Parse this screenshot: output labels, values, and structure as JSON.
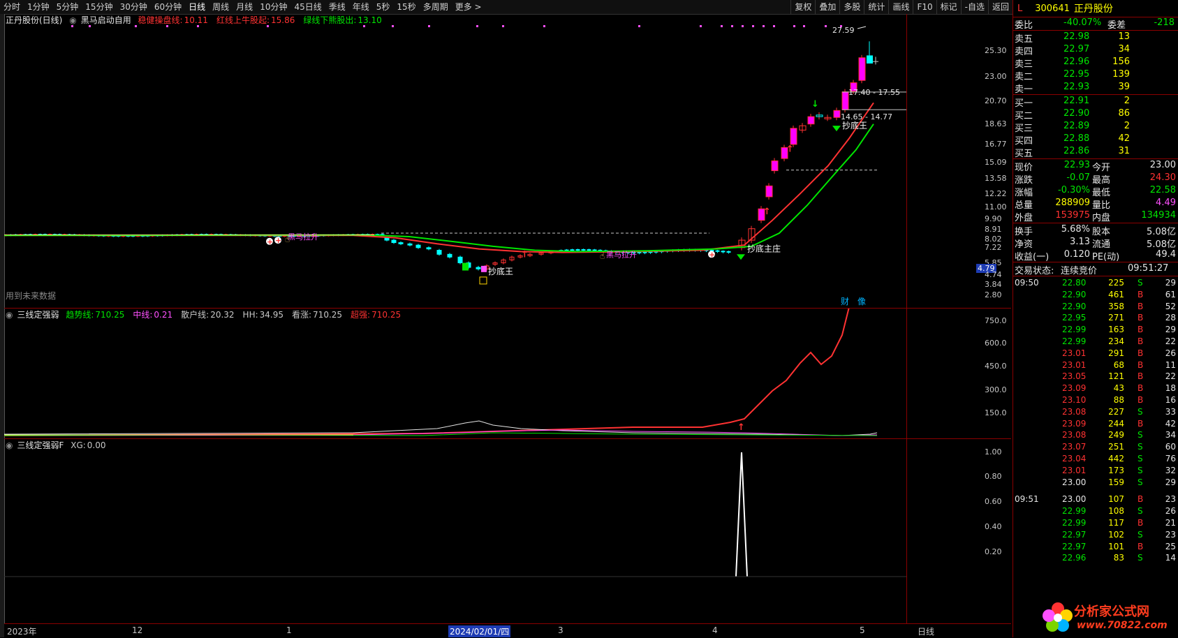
{
  "toolbar": {
    "tabs": [
      "分时",
      "1分钟",
      "5分钟",
      "15分钟",
      "30分钟",
      "60分钟",
      "日线",
      "周线",
      "月线",
      "10分钟",
      "45日线",
      "季线",
      "年线",
      "5秒",
      "15秒",
      "多周期",
      "更多 >"
    ],
    "right_tabs": [
      "复权",
      "叠加",
      "多股",
      "统计",
      "画线",
      "F10",
      "标记",
      "-自选",
      "返回"
    ]
  },
  "main_panel": {
    "stock_title": "正丹股份(日线)",
    "indicator_name": "黑马启动自用",
    "items": [
      {
        "label": "稳健操盘线:",
        "value": "10.11",
        "color": "#ff3232"
      },
      {
        "label": "红线上牛股起:",
        "value": "15.86",
        "color": "#ff3232"
      },
      {
        "label": "绿线下熊股出:",
        "value": "13.10",
        "color": "#00e600"
      }
    ],
    "note": "用到未来数据",
    "axis": [
      "25.30",
      "23.00",
      "20.70",
      "18.63",
      "16.77",
      "15.09",
      "13.58",
      "12.22",
      "11.00",
      "9.90",
      "8.91",
      "8.02",
      "7.22",
      "5.85",
      "4.79",
      "4.74",
      "3.84",
      "2.80"
    ],
    "highlight_price": "4.79",
    "annotations": {
      "high": "27.59",
      "range1": "17.40 - 17.55",
      "range2": "14.65 - 14.77",
      "label1": "抄底王",
      "label2": "黑马拉升",
      "label3": "抄底王",
      "label4": "黑马拉升",
      "label5": "抄底主庄",
      "label6": "抄底王",
      "cai": "财",
      "xiang": "像"
    }
  },
  "panel2": {
    "name": "三线定强弱",
    "items": [
      {
        "label": "趋势线:",
        "value": "710.25",
        "color": "#00e600"
      },
      {
        "label": "中线:",
        "value": "0.21",
        "color": "#ff50ff"
      },
      {
        "label": "散户线:",
        "value": "20.32",
        "color": "#c8c8c8"
      },
      {
        "label": "HH:",
        "value": "34.95",
        "color": "#c8c8c8"
      },
      {
        "label": "看涨:",
        "value": "710.25",
        "color": "#c8c8c8"
      },
      {
        "label": "超强:",
        "value": "710.25",
        "color": "#ff3232"
      }
    ],
    "axis": [
      "750.0",
      "600.0",
      "450.0",
      "300.0",
      "150.0"
    ]
  },
  "panel3": {
    "name": "三线定强弱F",
    "items": [
      {
        "label": "XG:",
        "value": "0.00",
        "color": "#c8c8c8"
      }
    ],
    "axis": [
      "1.00",
      "0.80",
      "0.60",
      "0.40",
      "0.20"
    ]
  },
  "x_axis": {
    "labels": [
      "2023年",
      "12",
      "1",
      "2024/02/01/四",
      "3",
      "4",
      "5"
    ],
    "period": "日线"
  },
  "quote": {
    "flag": "L",
    "code": "300641",
    "name": "正丹股份",
    "weibi_label": "委比",
    "weibi": "-40.07%",
    "weicha_label": "委差",
    "weicha": "-218",
    "asks": [
      {
        "label": "卖五",
        "price": "22.98",
        "vol": "13"
      },
      {
        "label": "卖四",
        "price": "22.97",
        "vol": "34"
      },
      {
        "label": "卖三",
        "price": "22.96",
        "vol": "156"
      },
      {
        "label": "卖二",
        "price": "22.95",
        "vol": "139"
      },
      {
        "label": "卖一",
        "price": "22.93",
        "vol": "39"
      }
    ],
    "bids": [
      {
        "label": "买一",
        "price": "22.91",
        "vol": "2"
      },
      {
        "label": "买二",
        "price": "22.90",
        "vol": "86"
      },
      {
        "label": "买三",
        "price": "22.89",
        "vol": "2"
      },
      {
        "label": "买四",
        "price": "22.88",
        "vol": "42"
      },
      {
        "label": "买五",
        "price": "22.86",
        "vol": "31"
      }
    ],
    "stats": [
      {
        "l1": "现价",
        "v1": "22.93",
        "c1": "#00e600",
        "l2": "今开",
        "v2": "23.00",
        "c2": "#e6e6e6"
      },
      {
        "l1": "涨跌",
        "v1": "-0.07",
        "c1": "#00e600",
        "l2": "最高",
        "v2": "24.30",
        "c2": "#ff3232"
      },
      {
        "l1": "涨幅",
        "v1": "-0.30%",
        "c1": "#00e600",
        "l2": "最低",
        "v2": "22.58",
        "c2": "#00e600"
      },
      {
        "l1": "总量",
        "v1": "288909",
        "c1": "#ffff00",
        "l2": "量比",
        "v2": "4.49",
        "c2": "#ff50ff"
      },
      {
        "l1": "外盘",
        "v1": "153975",
        "c1": "#ff3232",
        "l2": "内盘",
        "v2": "134934",
        "c2": "#00e600"
      }
    ],
    "stats2": [
      {
        "l1": "换手",
        "v1": "5.68%",
        "l2": "股本",
        "v2": "5.08亿"
      },
      {
        "l1": "净资",
        "v1": "3.13",
        "l2": "流通",
        "v2": "5.08亿"
      },
      {
        "l1": "收益(一)",
        "v1": "0.120",
        "l2": "PE(动)",
        "v2": "49.4"
      }
    ],
    "status_label": "交易状态:",
    "status": "连续竞价",
    "status_time": "09:51:27"
  },
  "trades": [
    {
      "time": "09:50",
      "price": "22.80",
      "vol": "225",
      "bs": "S",
      "n": "29"
    },
    {
      "time": "",
      "price": "22.90",
      "vol": "461",
      "bs": "B",
      "n": "61"
    },
    {
      "time": "",
      "price": "22.90",
      "vol": "358",
      "bs": "B",
      "n": "52"
    },
    {
      "time": "",
      "price": "22.95",
      "vol": "271",
      "bs": "B",
      "n": "28"
    },
    {
      "time": "",
      "price": "22.99",
      "vol": "163",
      "bs": "B",
      "n": "29"
    },
    {
      "time": "",
      "price": "22.99",
      "vol": "234",
      "bs": "B",
      "n": "22"
    },
    {
      "time": "",
      "price": "23.01",
      "vol": "291",
      "bs": "B",
      "n": "26"
    },
    {
      "time": "",
      "price": "23.01",
      "vol": "68",
      "bs": "B",
      "n": "11"
    },
    {
      "time": "",
      "price": "23.05",
      "vol": "121",
      "bs": "B",
      "n": "22"
    },
    {
      "time": "",
      "price": "23.09",
      "vol": "43",
      "bs": "B",
      "n": "18"
    },
    {
      "time": "",
      "price": "23.10",
      "vol": "88",
      "bs": "B",
      "n": "16"
    },
    {
      "time": "",
      "price": "23.08",
      "vol": "227",
      "bs": "S",
      "n": "33"
    },
    {
      "time": "",
      "price": "23.09",
      "vol": "244",
      "bs": "B",
      "n": "42"
    },
    {
      "time": "",
      "price": "23.08",
      "vol": "249",
      "bs": "S",
      "n": "34"
    },
    {
      "time": "",
      "price": "23.07",
      "vol": "251",
      "bs": "S",
      "n": "60"
    },
    {
      "time": "",
      "price": "23.04",
      "vol": "442",
      "bs": "S",
      "n": "76"
    },
    {
      "time": "",
      "price": "23.01",
      "vol": "173",
      "bs": "S",
      "n": "32"
    },
    {
      "time": "",
      "price": "23.00",
      "vol": "159",
      "bs": "S",
      "n": "29"
    },
    {
      "time": "09:51",
      "price": "23.00",
      "vol": "107",
      "bs": "B",
      "n": "23"
    },
    {
      "time": "",
      "price": "22.99",
      "vol": "108",
      "bs": "S",
      "n": "26"
    },
    {
      "time": "",
      "price": "22.99",
      "vol": "117",
      "bs": "B",
      "n": "21"
    },
    {
      "time": "",
      "price": "22.97",
      "vol": "102",
      "bs": "S",
      "n": "23"
    },
    {
      "time": "",
      "price": "22.97",
      "vol": "101",
      "bs": "B",
      "n": "25"
    },
    {
      "time": "",
      "price": "22.96",
      "vol": "83",
      "bs": "S",
      "n": "14"
    }
  ],
  "logo": {
    "line1": "分析家公式网",
    "line2": "www.70822.com"
  }
}
